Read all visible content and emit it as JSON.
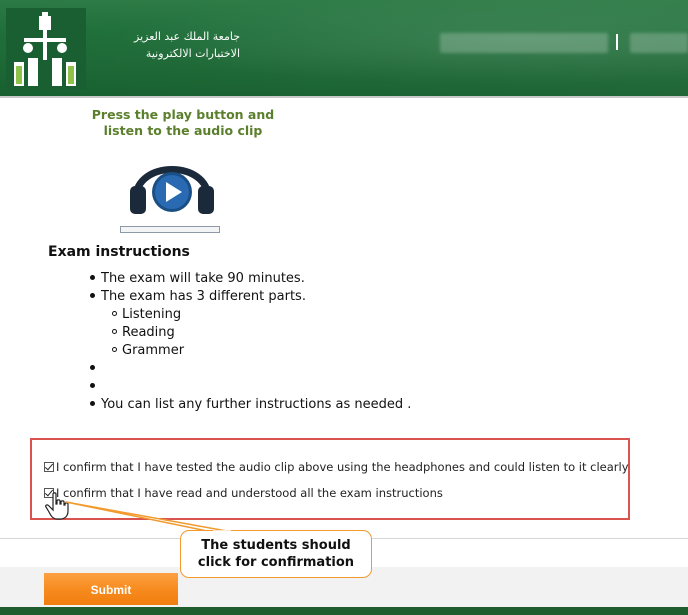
{
  "header": {
    "university_name": "جامعة الملك عبد العزيز",
    "system_name": "الاختبارات الالكترونية",
    "logo_icon": "university-logo-icon",
    "colors": {
      "green": "#1e6a37"
    }
  },
  "audio": {
    "prompt_line1": "Press the play button and",
    "prompt_line2": "listen to the audio clip",
    "player_icon": "headphones-play-icon",
    "progress": 0
  },
  "instructions": {
    "title": "Exam instructions",
    "items": [
      "The exam will take 90 minutes.",
      "The exam has 3 different parts."
    ],
    "sub_items": [
      "Listening",
      "Reading",
      "Grammer"
    ],
    "last_item": "You can list any further instructions as needed ."
  },
  "confirmations": {
    "items": [
      {
        "label": "I confirm that I have tested the audio clip above using the headphones and could listen to it clearly",
        "checked": true
      },
      {
        "label": "I confirm that I have read and understood all the exam instructions",
        "checked": true
      }
    ]
  },
  "actions": {
    "submit_label": "Submit"
  },
  "callout": {
    "line1": "The students should",
    "line2": "click for confirmation",
    "accent": "#f29a2e"
  },
  "colors": {
    "highlight_box": "#d9534f",
    "submit": "#f78a1d",
    "prompt": "#5b7f2c"
  }
}
